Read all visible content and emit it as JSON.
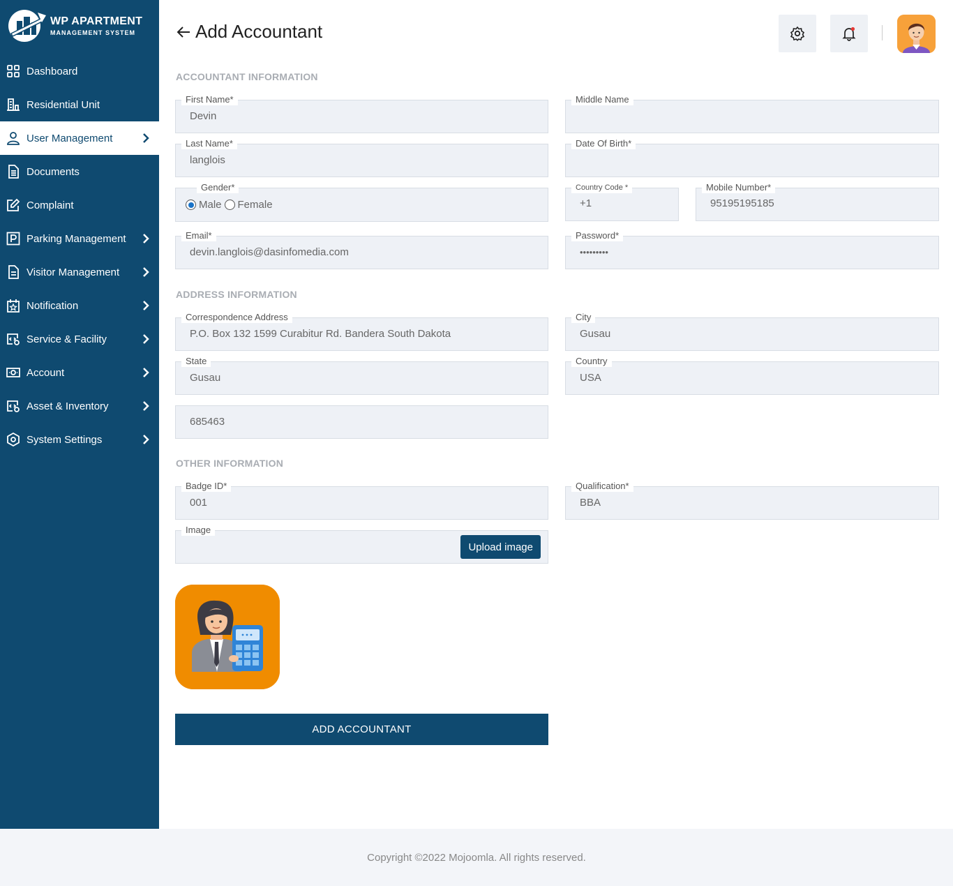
{
  "app": {
    "logo_title": "WP APARTMENT",
    "logo_subtitle": "MANAGEMENT SYSTEM"
  },
  "sidebar": {
    "items": [
      {
        "label": "Dashboard",
        "icon": "grid-icon"
      },
      {
        "label": "Residential Unit",
        "icon": "building-icon"
      },
      {
        "label": "User Management",
        "icon": "user-icon",
        "active": true
      },
      {
        "label": "Documents",
        "icon": "document-icon"
      },
      {
        "label": "Complaint",
        "icon": "edit-icon"
      },
      {
        "label": "Parking Management",
        "icon": "parking-icon"
      },
      {
        "label": "Visitor Management",
        "icon": "clipboard-icon"
      },
      {
        "label": "Notification",
        "icon": "calendar-star-icon"
      },
      {
        "label": "Service & Facility",
        "icon": "service-icon"
      },
      {
        "label": "Account",
        "icon": "money-icon"
      },
      {
        "label": "Asset & Inventory",
        "icon": "asset-icon"
      },
      {
        "label": "System Settings",
        "icon": "settings-icon"
      }
    ]
  },
  "header": {
    "title": "Add Accountant"
  },
  "sections": {
    "accountant": "ACCOUNTANT INFORMATION",
    "address": "ADDRESS INFORMATION",
    "other": "OTHER INFORMATION"
  },
  "form": {
    "first_name": {
      "label": "First Name*",
      "value": "Devin"
    },
    "middle_name": {
      "label": "Middle Name",
      "value": ""
    },
    "last_name": {
      "label": "Last Name*",
      "value": "langlois"
    },
    "dob": {
      "label": "Date Of Birth*",
      "value": ""
    },
    "gender": {
      "label": "Gender*",
      "options": [
        "Male",
        "Female"
      ],
      "selected": "Male"
    },
    "country_code": {
      "label": "Country Code *",
      "value": "+1"
    },
    "mobile": {
      "label": "Mobile Number*",
      "value": "95195195185"
    },
    "email": {
      "label": "Email*",
      "value": "devin.langlois@dasinfomedia.com"
    },
    "password": {
      "label": "Password*",
      "value": "•••••••••"
    },
    "address": {
      "label": "Correspondence Address",
      "value": "P.O. Box 132 1599 Curabitur Rd. Bandera South Dakota"
    },
    "city": {
      "label": "City",
      "value": "Gusau"
    },
    "state": {
      "label": "State",
      "value": "Gusau"
    },
    "country": {
      "label": "Country",
      "value": "USA"
    },
    "zip": {
      "value": "685463"
    },
    "badge_id": {
      "label": "Badge ID*",
      "value": "001"
    },
    "qualification": {
      "label": "Qualification*",
      "value": "BBA"
    },
    "image": {
      "label": "Image",
      "button": "Upload image"
    },
    "submit": "ADD ACCOUNTANT"
  },
  "colors": {
    "sidebar": "#0f4a70",
    "field_bg": "#eef1f6",
    "preview_bg": "#f08c00",
    "avatar_bg": "#f7a13a"
  },
  "footer": {
    "text": "Copyright ©2022 Mojoomla. All rights reserved."
  }
}
